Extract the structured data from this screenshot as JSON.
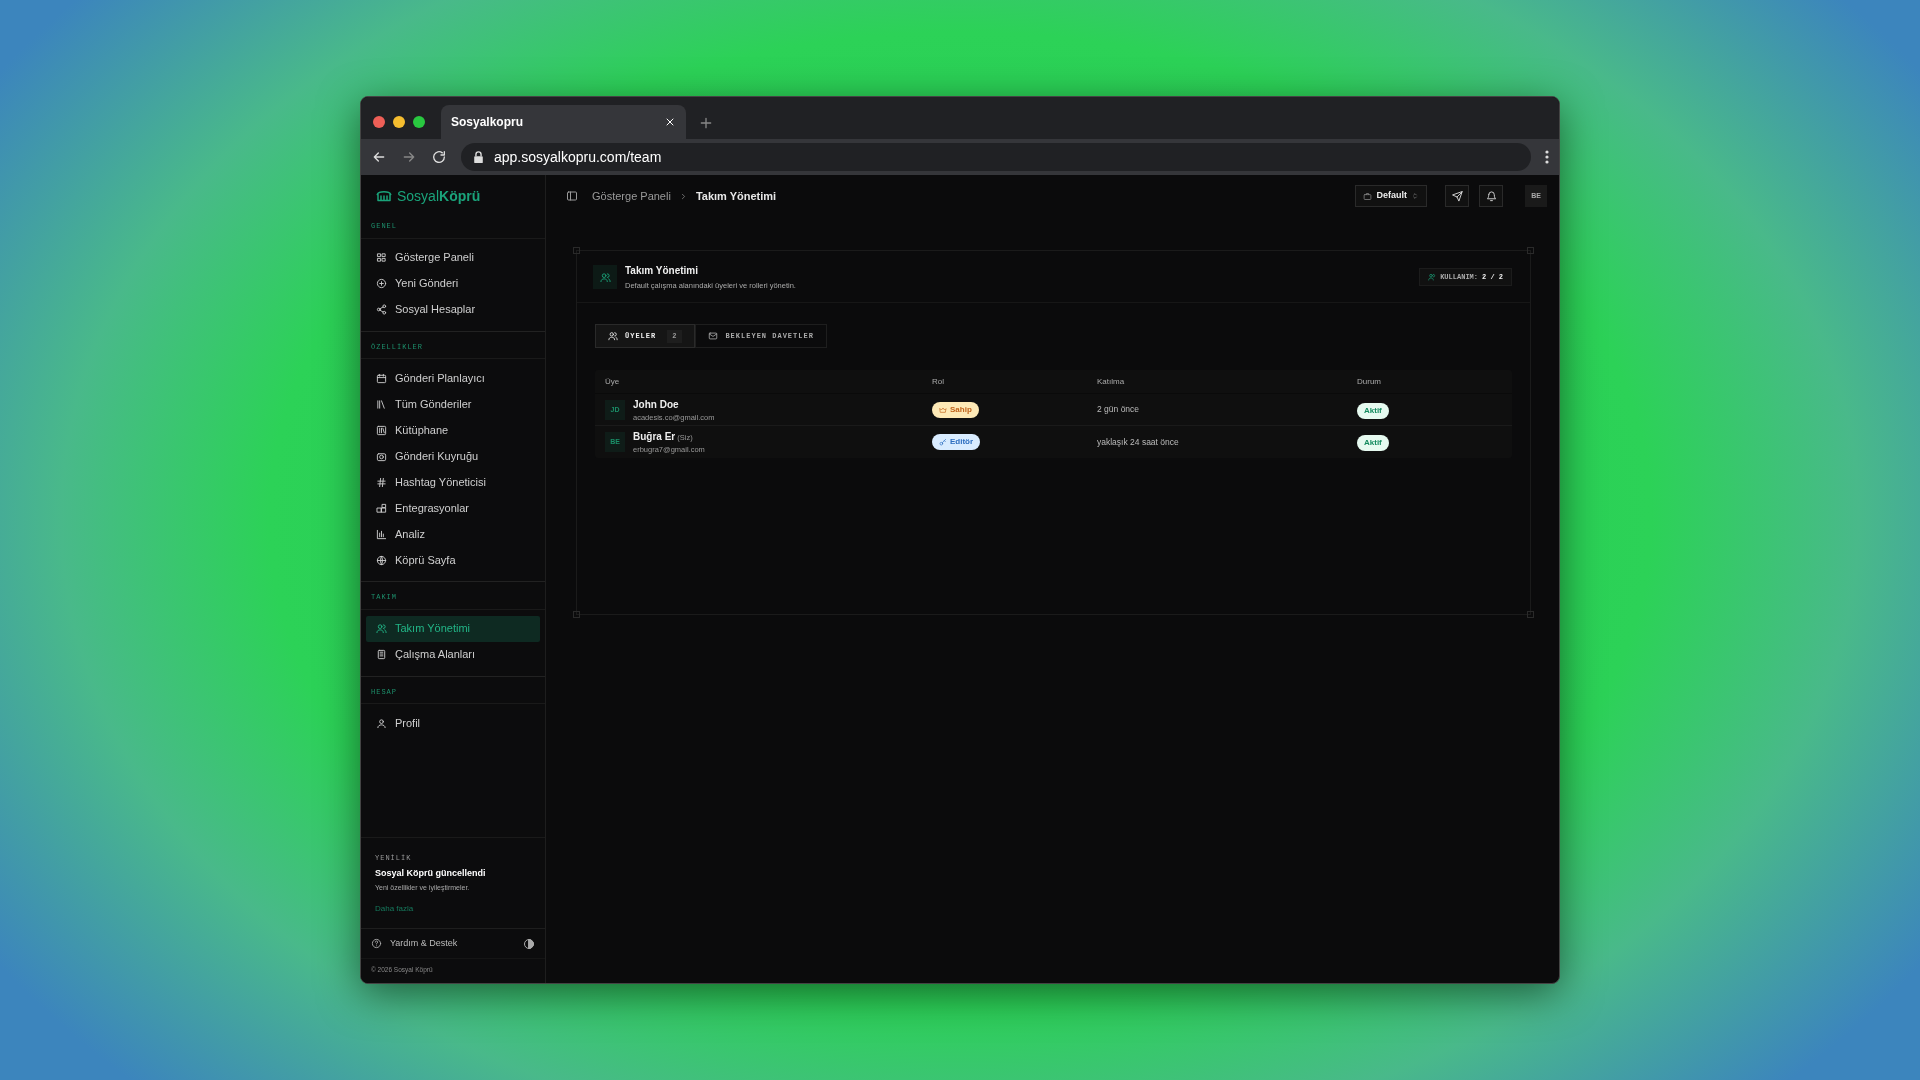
{
  "browser": {
    "tab_title": "Sosyalkopru",
    "url": "app.sosyalkopru.com/team"
  },
  "logo": {
    "part_1": "Sosyal",
    "part_2": "Köprü"
  },
  "sidebar": {
    "sections": [
      {
        "title": "GENEL",
        "items": [
          {
            "label": "Gösterge Paneli",
            "selected": false
          },
          {
            "label": "Yeni Gönderi",
            "selected": false
          },
          {
            "label": "Sosyal Hesaplar",
            "selected": false
          }
        ]
      },
      {
        "title": "ÖZELLİKLER",
        "items": [
          {
            "label": "Gönderi Planlayıcı",
            "selected": false
          },
          {
            "label": "Tüm Gönderiler",
            "selected": false
          },
          {
            "label": "Kütüphane",
            "selected": false
          },
          {
            "label": "Gönderi Kuyruğu",
            "selected": false
          },
          {
            "label": "Hashtag Yöneticisi",
            "selected": false
          },
          {
            "label": "Entegrasyonlar",
            "selected": false
          },
          {
            "label": "Analiz",
            "selected": false
          },
          {
            "label": "Köprü Sayfa",
            "selected": false
          }
        ]
      },
      {
        "title": "TAKIM",
        "items": [
          {
            "label": "Takım Yönetimi",
            "selected": true
          },
          {
            "label": "Çalışma Alanları",
            "selected": false
          }
        ]
      },
      {
        "title": "HESAP",
        "items": [
          {
            "label": "Profil",
            "selected": false
          }
        ]
      }
    ],
    "news": {
      "tag": "YENİLİK",
      "title": "Sosyal Köprü güncellendi",
      "text": "Yeni özellikler ve iyileştirmeler.",
      "link": "Daha fazla"
    },
    "help": "Yardım & Destek",
    "copyright": "© 2026 Sosyal Köprü"
  },
  "breadcrumb": [
    "Gösterge Paneli",
    "Takım Yönetimi"
  ],
  "workspace": "Default",
  "avatar": "BE",
  "page": {
    "title": "Takım Yönetimi",
    "subtitle": "Default çalışma alanındaki üyeleri ve rolleri yönetin.",
    "usage_label": "KULLANIM:",
    "usage_value": "2 / 2",
    "tabs": [
      {
        "label": "ÜYELER",
        "count": "2",
        "selected": true
      },
      {
        "label": "BEKLEYEN DAVETLER",
        "selected": false
      }
    ],
    "table": {
      "columns": [
        "Üye",
        "Rol",
        "Katılma",
        "Durum"
      ],
      "rows": [
        {
          "initials": "JD",
          "name": "John Doe",
          "email": "acadesis.co@gmail.com",
          "role": "Sahip",
          "kind": "owner",
          "joined": "2 gün önce",
          "status": "Aktif"
        },
        {
          "initials": "BE",
          "name": "Buğra Er",
          "you": "(Siz)",
          "email": "erbugra7@gmail.com",
          "role": "Editör",
          "kind": "editor",
          "joined": "yaklaşık 24 saat önce",
          "status": "Aktif"
        }
      ]
    }
  }
}
